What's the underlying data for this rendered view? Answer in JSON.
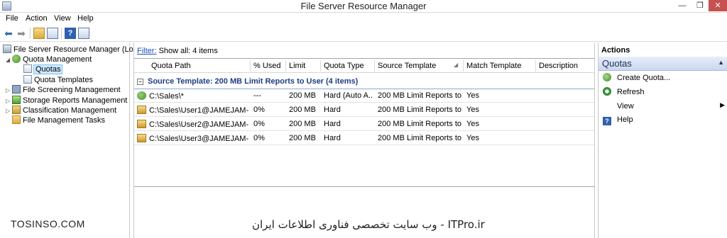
{
  "window": {
    "title": "File Server Resource Manager",
    "min_glyph": "—",
    "max_glyph": "❐",
    "close_glyph": "✕"
  },
  "menu": [
    "File",
    "Action",
    "View",
    "Help"
  ],
  "toolbar": {
    "back_glyph": "⬅",
    "forward_glyph": "➡",
    "help_glyph": "?"
  },
  "tree": {
    "root": "File Server Resource Manager (Local)",
    "quota_management": "Quota Management",
    "quotas": "Quotas",
    "quota_templates": "Quota Templates",
    "file_screening": "File Screening Management",
    "storage_reports": "Storage Reports Management",
    "classification": "Classification Management",
    "file_tasks": "File Management Tasks"
  },
  "filter": {
    "label": "Filter:",
    "text": "Show all: 4 items"
  },
  "columns": [
    "Quota Path",
    "% Used",
    "Limit",
    "Quota Type",
    "Source Template",
    "Match Template",
    "Description"
  ],
  "group": {
    "label": "Source Template: 200 MB Limit Reports to User (4 items)",
    "toggle": "−"
  },
  "rows": [
    {
      "path": "C:\\Sales\\*",
      "used": "---",
      "limit": "200 MB",
      "type": "Hard (Auto A...",
      "template": "200 MB Limit Reports to ...",
      "match": "Yes",
      "icon": "auto-apply-quota-icon"
    },
    {
      "path": "C:\\Sales\\User1@JAMEJAM-K...",
      "used": "0%",
      "limit": "200 MB",
      "type": "Hard",
      "template": "200 MB Limit Reports to ...",
      "match": "Yes",
      "icon": "quota-folder-icon"
    },
    {
      "path": "C:\\Sales\\User2@JAMEJAM-K...",
      "used": "0%",
      "limit": "200 MB",
      "type": "Hard",
      "template": "200 MB Limit Reports to ...",
      "match": "Yes",
      "icon": "quota-folder-icon"
    },
    {
      "path": "C:\\Sales\\User3@JAMEJAM-K...",
      "used": "0%",
      "limit": "200 MB",
      "type": "Hard",
      "template": "200 MB Limit Reports to ...",
      "match": "Yes",
      "icon": "quota-folder-icon"
    }
  ],
  "actions": {
    "title": "Actions",
    "section": "Quotas",
    "items": [
      "Create Quota...",
      "Refresh",
      "View",
      "Help"
    ]
  },
  "watermarks": {
    "left": "TOSINSO.COM",
    "right": "ITPro.ir - وب سایت تخصصی فناوری اطلاعات ایران"
  },
  "colors": {
    "group_header": "#1e3c84",
    "selection": "#cde8ff",
    "filter_link": "#1a4fb8"
  }
}
